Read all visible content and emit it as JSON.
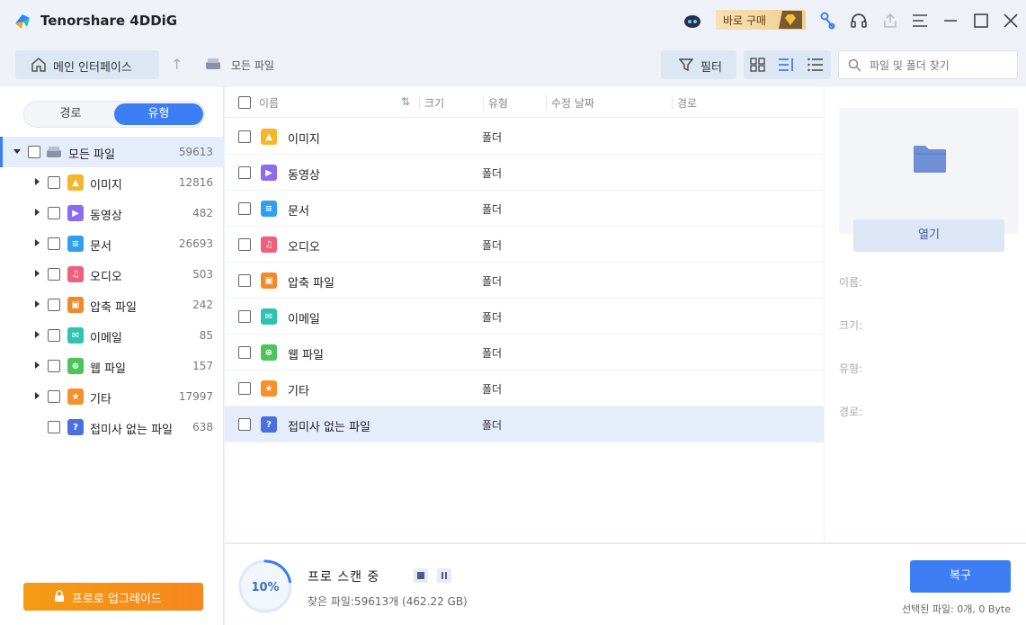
{
  "app": {
    "title": "Tenorshare 4DDiG",
    "buy_label": "바로 구매"
  },
  "nav": {
    "home_label": "메인 인터페이스",
    "breadcrumb": "모든 파일",
    "filter_label": "필터",
    "search_placeholder": "파일 및 폴더 찾기"
  },
  "sidebar": {
    "seg_path": "경로",
    "seg_type": "유형",
    "root": {
      "label": "모든 파일",
      "count": "59613"
    },
    "items": [
      {
        "label": "이미지",
        "count": "12816",
        "color": "#f5b72a",
        "glyph": "▲"
      },
      {
        "label": "동영상",
        "count": "482",
        "color": "#8b6cf0",
        "glyph": "▶"
      },
      {
        "label": "문서",
        "count": "26693",
        "color": "#2fa0f0",
        "glyph": "≡"
      },
      {
        "label": "오디오",
        "count": "503",
        "color": "#f0607a",
        "glyph": "♫"
      },
      {
        "label": "압축 파일",
        "count": "242",
        "color": "#f08a2a",
        "glyph": "▣"
      },
      {
        "label": "이메일",
        "count": "85",
        "color": "#2cc4b0",
        "glyph": "✉"
      },
      {
        "label": "웹 파일",
        "count": "157",
        "color": "#4cc45a",
        "glyph": "⊕"
      },
      {
        "label": "기타",
        "count": "17997",
        "color": "#f5902a",
        "glyph": "★"
      },
      {
        "label": "접미사 없는 파일",
        "count": "638",
        "color": "#4a70e0",
        "glyph": "?"
      }
    ],
    "upgrade_label": "프로로 업그레이드"
  },
  "table": {
    "headers": {
      "name": "이름",
      "size": "크기",
      "type": "유형",
      "modified": "수정 날짜",
      "path": "경로"
    },
    "rows": [
      {
        "name": "이미지",
        "type": "폴더"
      },
      {
        "name": "동영상",
        "type": "폴더"
      },
      {
        "name": "문서",
        "type": "폴더"
      },
      {
        "name": "오디오",
        "type": "폴더"
      },
      {
        "name": "압축 파일",
        "type": "폴더"
      },
      {
        "name": "이메일",
        "type": "폴더"
      },
      {
        "name": "웹 파일",
        "type": "폴더"
      },
      {
        "name": "기타",
        "type": "폴더"
      },
      {
        "name": "접미사 없는 파일",
        "type": "폴더"
      }
    ]
  },
  "details": {
    "open_label": "열기",
    "name_label": "이름:",
    "size_label": "크기:",
    "type_label": "유형:",
    "path_label": "경로:"
  },
  "scan": {
    "progress_text": "10%",
    "progress": 0.1,
    "title": "프로 스캔 중",
    "found": "찾은 파일:59613개 (462.22 GB)"
  },
  "footer": {
    "recover_label": "복구",
    "selected_info": "선택된 파일: 0개, 0 Byte"
  },
  "colors": {
    "accent": "#3d7ef5",
    "upgrade": "#f5901e",
    "selected_row": "#e5edfb"
  }
}
